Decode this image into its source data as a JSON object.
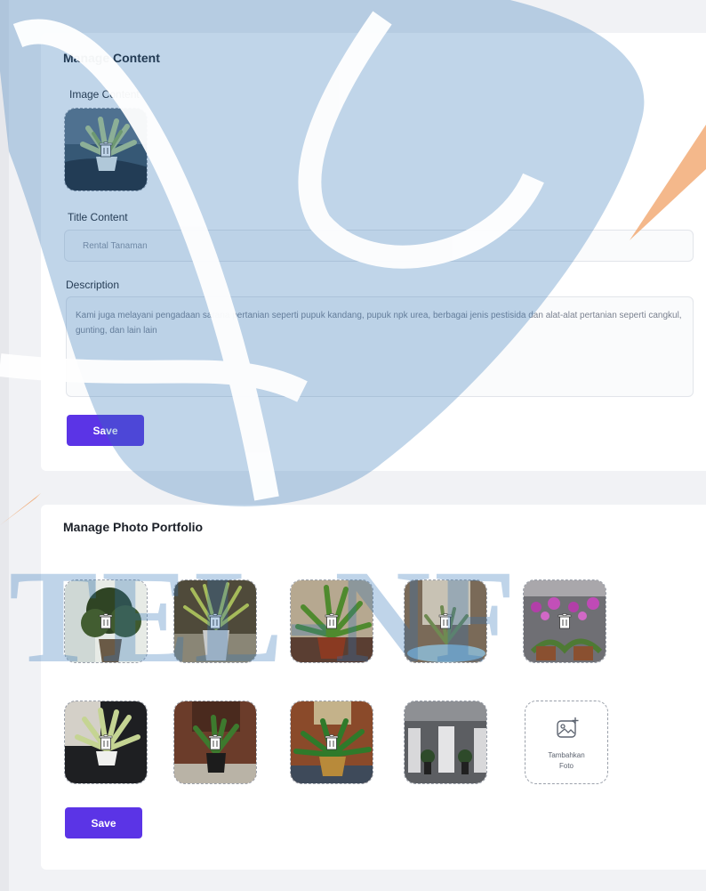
{
  "content": {
    "title": "Manage Content",
    "image_label": "Image Content",
    "title_label": "Title Content",
    "title_value": "Rental Tanaman",
    "description_label": "Description",
    "description_value": "Kami juga melayani pengadaan sarana pertanian seperti pupuk kandang, pupuk npk urea, berbagai jenis pestisida dan alat-alat pertanian seperti cangkul, gunting, dan lain lain",
    "save_label": "Save"
  },
  "portfolio": {
    "title": "Manage Photo Portfolio",
    "add_label_line1": "Tambahkan",
    "add_label_line2": "Foto",
    "save_label": "Save",
    "photo_count": 9
  },
  "watermark": {
    "text": "TEL-NF"
  },
  "colors": {
    "accent": "#5b34e6",
    "watermark_blue": "#2f73b7",
    "watermark_orange": "#f0a064"
  }
}
